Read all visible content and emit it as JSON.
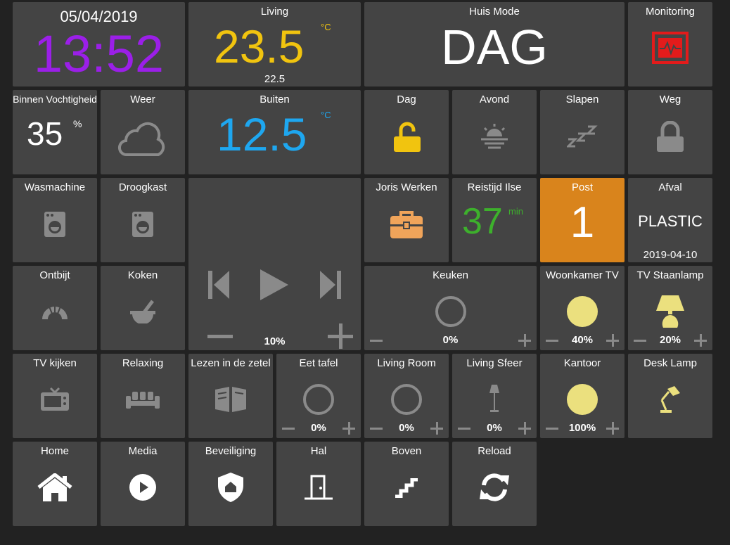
{
  "clock": {
    "date": "05/04/2019",
    "time": "13:52"
  },
  "living": {
    "title": "Living",
    "temp": "23.5",
    "unit": "°C",
    "setpoint": "22.5"
  },
  "huismode": {
    "title": "Huis Mode",
    "value": "DAG"
  },
  "monitoring": {
    "title": "Monitoring",
    "icon": "monitor-pulse-icon"
  },
  "vocht": {
    "title": "Binnen Vochtigheid",
    "value": "35",
    "unit": "%"
  },
  "weer": {
    "title": "Weer",
    "icon": "cloud-icon"
  },
  "buiten": {
    "title": "Buiten",
    "temp": "12.5",
    "unit": "°C"
  },
  "modes": {
    "dag": {
      "title": "Dag",
      "icon": "unlocked-padlock-icon"
    },
    "avond": {
      "title": "Avond",
      "icon": "sunset-icon"
    },
    "slapen": {
      "title": "Slapen",
      "icon": "sleep-zzz-icon"
    },
    "weg": {
      "title": "Weg",
      "icon": "locked-padlock-icon"
    }
  },
  "wasmachine": {
    "title": "Wasmachine",
    "icon": "washing-machine-icon"
  },
  "droogkast": {
    "title": "Droogkast",
    "icon": "dryer-icon"
  },
  "media": {
    "volume": "10%"
  },
  "joris": {
    "title": "Joris Werken",
    "icon": "briefcase-icon"
  },
  "reistijd": {
    "title": "Reistijd Ilse",
    "value": "37",
    "unit": "min"
  },
  "post": {
    "title": "Post",
    "value": "1"
  },
  "afval": {
    "title": "Afval",
    "value": "PLASTIC",
    "date": "2019-04-10"
  },
  "ontbijt": {
    "title": "Ontbijt",
    "icon": "croissant-icon"
  },
  "koken": {
    "title": "Koken",
    "icon": "mortar-pestle-icon"
  },
  "keuken": {
    "title": "Keuken",
    "value": "0%"
  },
  "woonkamertv": {
    "title": "Woonkamer TV",
    "value": "40%"
  },
  "staanlamp": {
    "title": "TV Staanlamp",
    "value": "20%"
  },
  "tvkijken": {
    "title": "TV kijken",
    "icon": "tv-icon"
  },
  "relaxing": {
    "title": "Relaxing",
    "icon": "sofa-icon"
  },
  "lezen": {
    "title": "Lezen in de zetel",
    "icon": "open-book-icon"
  },
  "eettafel": {
    "title": "Eet tafel",
    "value": "0%"
  },
  "livingroom": {
    "title": "Living Room",
    "value": "0%"
  },
  "livingsfeer": {
    "title": "Living Sfeer",
    "value": "0%"
  },
  "kantoor": {
    "title": "Kantoor",
    "value": "100%"
  },
  "desklamp": {
    "title": "Desk Lamp",
    "icon": "desk-lamp-icon"
  },
  "nav": {
    "home": {
      "title": "Home",
      "icon": "home-icon"
    },
    "media": {
      "title": "Media",
      "icon": "play-circle-icon"
    },
    "beveiliging": {
      "title": "Beveiliging",
      "icon": "shield-home-icon"
    },
    "hal": {
      "title": "Hal",
      "icon": "door-icon"
    },
    "boven": {
      "title": "Boven",
      "icon": "stairs-icon"
    },
    "reload": {
      "title": "Reload",
      "icon": "reload-icon"
    }
  },
  "colors": {
    "purple": "#9b1fe8",
    "yellow": "#f1c40f",
    "blue": "#1ea7f0",
    "green": "#3db02c",
    "orange": "#d9841c",
    "bulb": "#ebe07e",
    "red": "#e31b1b"
  }
}
